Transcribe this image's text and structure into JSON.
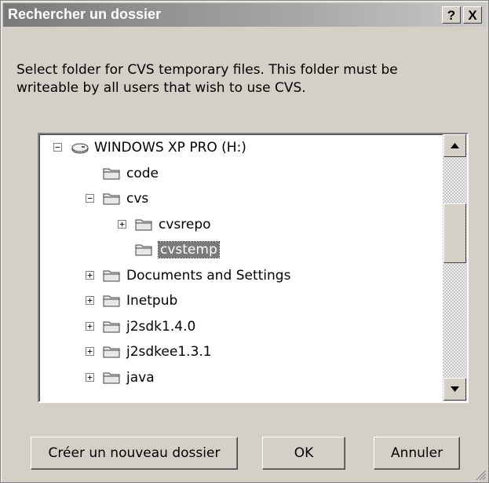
{
  "dialog": {
    "title": "Rechercher un dossier",
    "help_label": "?",
    "close_label": "X",
    "description": "Select folder for CVS temporary files.  This folder must be\nwriteable by all users that wish to use CVS."
  },
  "tree": {
    "items": [
      {
        "label": "WINDOWS XP PRO (H:)",
        "expander": "−",
        "icon": "drive-icon"
      },
      {
        "label": "code",
        "expander": "",
        "icon": "folder-icon"
      },
      {
        "label": "cvs",
        "expander": "−",
        "icon": "folder-open-icon"
      },
      {
        "label": "cvsrepo",
        "expander": "+",
        "icon": "folder-icon"
      },
      {
        "label": "cvstemp",
        "expander": "",
        "icon": "folder-open-icon",
        "selected": true
      },
      {
        "label": "Documents and Settings",
        "expander": "+",
        "icon": "folder-icon"
      },
      {
        "label": "Inetpub",
        "expander": "+",
        "icon": "folder-icon"
      },
      {
        "label": "j2sdk1.4.0",
        "expander": "+",
        "icon": "folder-icon"
      },
      {
        "label": "j2sdkee1.3.1",
        "expander": "+",
        "icon": "folder-icon"
      },
      {
        "label": "java",
        "expander": "+",
        "icon": "folder-icon"
      }
    ]
  },
  "buttons": {
    "new_folder": "Créer un nouveau dossier",
    "ok": "OK",
    "cancel": "Annuler"
  }
}
